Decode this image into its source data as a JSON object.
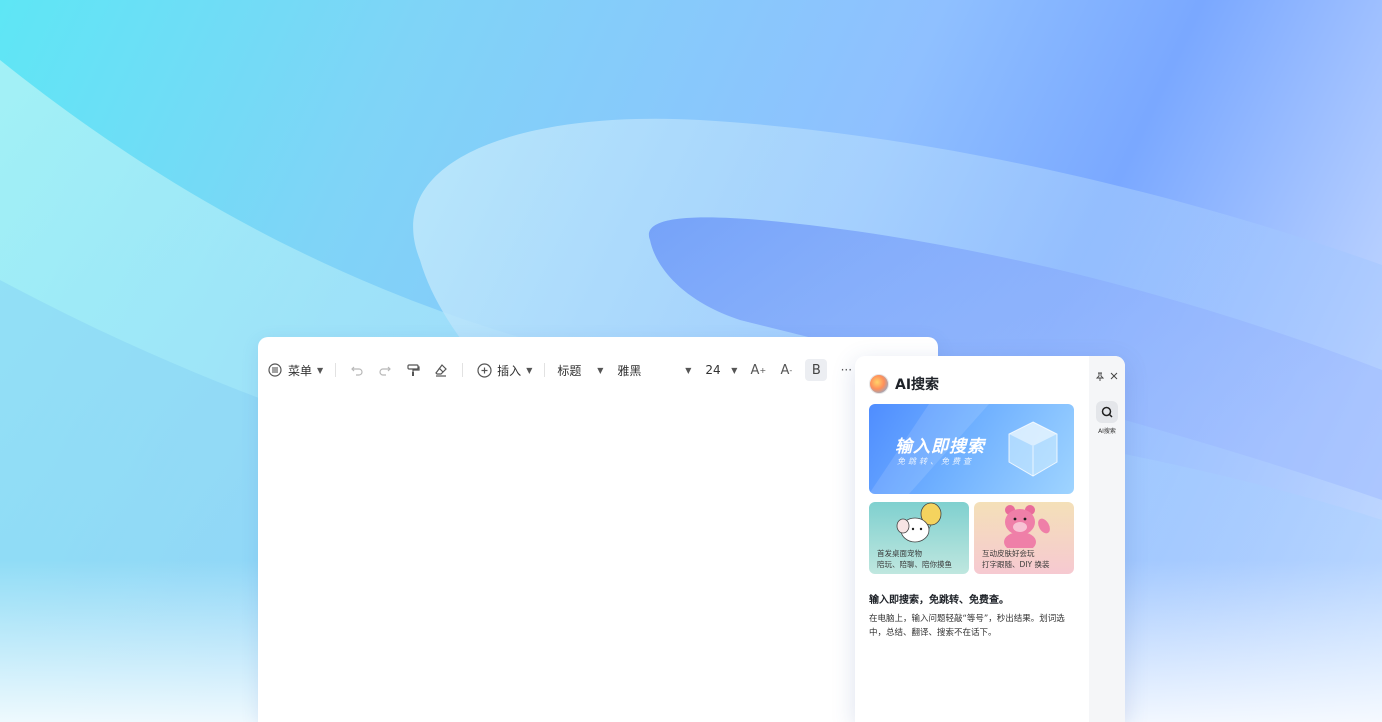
{
  "toolbar": {
    "menu_label": "菜单",
    "insert_label": "插入",
    "heading_style": "标题",
    "font_family_value": "雅黑",
    "font_size_value": "24",
    "bold_label": "B",
    "more_label": "···"
  },
  "panel": {
    "title": "AI搜索",
    "banner_title": "输入即搜索",
    "banner_subtitle": "免跳转、免费查",
    "cards": [
      {
        "line1": "首发桌面宠物",
        "line2": "陪玩、陪聊、陪你摸鱼"
      },
      {
        "line1": "互动皮肤好会玩",
        "line2": "打字跟随、DIY 换装"
      }
    ],
    "desc_title": "输入即搜索，免跳转、免费查。",
    "desc_body": "在电脑上，输入问题轻敲“等号”，秒出结果。划词选中，总结、翻译、搜索不在话下。",
    "rail_label": "AI搜索"
  },
  "colors": {
    "accent": "#4f8dff",
    "panel_bg": "#ffffff",
    "rail_bg": "#f5f6f8"
  }
}
